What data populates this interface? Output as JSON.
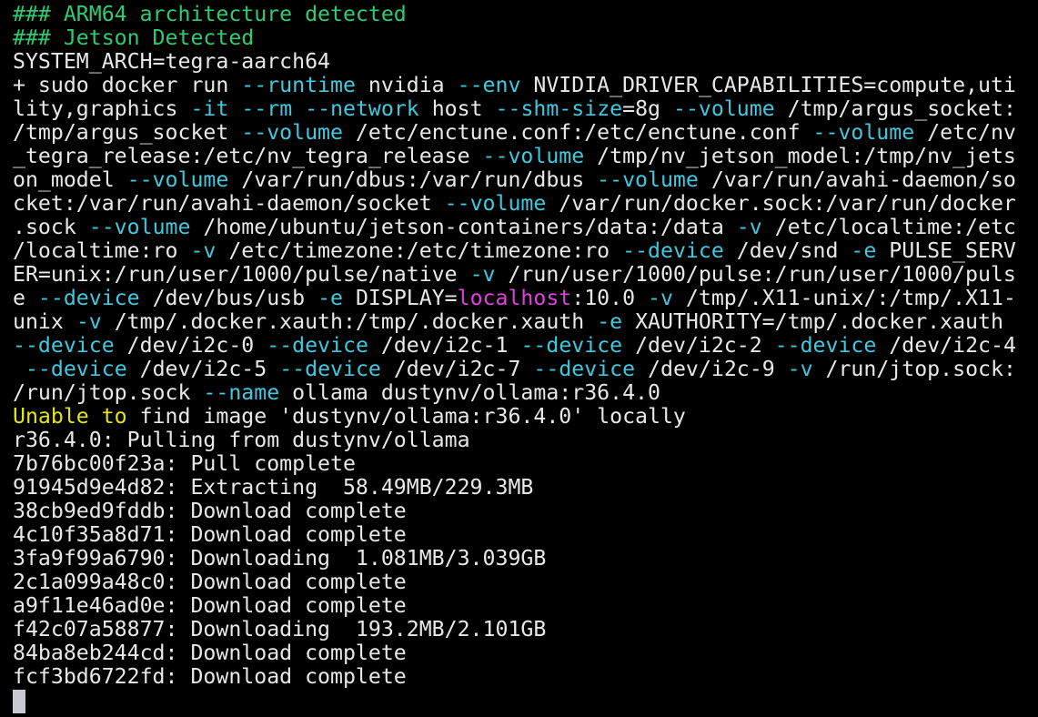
{
  "terminal": {
    "colors": {
      "background": "#000000",
      "default": "#e8e8e8",
      "green": "#2ecc71",
      "cyan": "#3fc9e0",
      "yellow": "#e5e510",
      "magenta": "#e040e0",
      "cursor": "#c9c9d3"
    },
    "lines": [
      [
        {
          "t": "                                 ",
          "c": "default"
        }
      ],
      [
        {
          "t": "### ARM64 architecture detected",
          "c": "green"
        }
      ],
      [
        {
          "t": "### Jetson Detected",
          "c": "green"
        }
      ],
      [
        {
          "t": "SYSTEM_ARCH=tegra-aarch64",
          "c": "default"
        }
      ],
      [
        {
          "t": "+ sudo docker run ",
          "c": "default"
        },
        {
          "t": "--runtime",
          "c": "cyan"
        },
        {
          "t": " nvidia ",
          "c": "default"
        },
        {
          "t": "--env",
          "c": "cyan"
        },
        {
          "t": " NVIDIA_DRIVER_CAPABILITIES=compute,uti",
          "c": "default"
        }
      ],
      [
        {
          "t": "lity,graphics ",
          "c": "default"
        },
        {
          "t": "-it",
          "c": "cyan"
        },
        {
          "t": " ",
          "c": "default"
        },
        {
          "t": "--rm",
          "c": "cyan"
        },
        {
          "t": " ",
          "c": "default"
        },
        {
          "t": "--network",
          "c": "cyan"
        },
        {
          "t": " host ",
          "c": "default"
        },
        {
          "t": "--shm-size",
          "c": "cyan"
        },
        {
          "t": "=8g ",
          "c": "default"
        },
        {
          "t": "--volume",
          "c": "cyan"
        },
        {
          "t": " /tmp/argus_socket:",
          "c": "default"
        }
      ],
      [
        {
          "t": "/tmp/argus_socket ",
          "c": "default"
        },
        {
          "t": "--volume",
          "c": "cyan"
        },
        {
          "t": " /etc/enctune.conf:/etc/enctune.conf ",
          "c": "default"
        },
        {
          "t": "--volume",
          "c": "cyan"
        },
        {
          "t": " /etc/nv",
          "c": "default"
        }
      ],
      [
        {
          "t": "_tegra_release:/etc/nv_tegra_release ",
          "c": "default"
        },
        {
          "t": "--volume",
          "c": "cyan"
        },
        {
          "t": " /tmp/nv_jetson_model:/tmp/nv_jets",
          "c": "default"
        }
      ],
      [
        {
          "t": "on_model ",
          "c": "default"
        },
        {
          "t": "--volume",
          "c": "cyan"
        },
        {
          "t": " /var/run/dbus:/var/run/dbus ",
          "c": "default"
        },
        {
          "t": "--volume",
          "c": "cyan"
        },
        {
          "t": " /var/run/avahi-daemon/so",
          "c": "default"
        }
      ],
      [
        {
          "t": "cket:/var/run/avahi-daemon/socket ",
          "c": "default"
        },
        {
          "t": "--volume",
          "c": "cyan"
        },
        {
          "t": " /var/run/docker.sock:/var/run/docker",
          "c": "default"
        }
      ],
      [
        {
          "t": ".sock ",
          "c": "default"
        },
        {
          "t": "--volume",
          "c": "cyan"
        },
        {
          "t": " /home/ubuntu/jetson-containers/data:/data ",
          "c": "default"
        },
        {
          "t": "-v",
          "c": "cyan"
        },
        {
          "t": " /etc/localtime:/etc",
          "c": "default"
        }
      ],
      [
        {
          "t": "/localtime:ro ",
          "c": "default"
        },
        {
          "t": "-v",
          "c": "cyan"
        },
        {
          "t": " /etc/timezone:/etc/timezone:ro ",
          "c": "default"
        },
        {
          "t": "--device",
          "c": "cyan"
        },
        {
          "t": " /dev/snd ",
          "c": "default"
        },
        {
          "t": "-e",
          "c": "cyan"
        },
        {
          "t": " PULSE_SERV",
          "c": "default"
        }
      ],
      [
        {
          "t": "ER=unix:/run/user/1000/pulse/native ",
          "c": "default"
        },
        {
          "t": "-v",
          "c": "cyan"
        },
        {
          "t": " /run/user/1000/pulse:/run/user/1000/puls",
          "c": "default"
        }
      ],
      [
        {
          "t": "e ",
          "c": "default"
        },
        {
          "t": "--device",
          "c": "cyan"
        },
        {
          "t": " /dev/bus/usb ",
          "c": "default"
        },
        {
          "t": "-e",
          "c": "cyan"
        },
        {
          "t": " DISPLAY=",
          "c": "default"
        },
        {
          "t": "localhost",
          "c": "magenta"
        },
        {
          "t": ":10.0 ",
          "c": "default"
        },
        {
          "t": "-v",
          "c": "cyan"
        },
        {
          "t": " /tmp/.X11-unix/:/tmp/.X11-",
          "c": "default"
        }
      ],
      [
        {
          "t": "unix ",
          "c": "default"
        },
        {
          "t": "-v",
          "c": "cyan"
        },
        {
          "t": " /tmp/.docker.xauth:/tmp/.docker.xauth ",
          "c": "default"
        },
        {
          "t": "-e",
          "c": "cyan"
        },
        {
          "t": " XAUTHORITY=/tmp/.docker.xauth",
          "c": "default"
        }
      ],
      [
        {
          "t": "--device",
          "c": "cyan"
        },
        {
          "t": " /dev/i2c-0 ",
          "c": "default"
        },
        {
          "t": "--device",
          "c": "cyan"
        },
        {
          "t": " /dev/i2c-1 ",
          "c": "default"
        },
        {
          "t": "--device",
          "c": "cyan"
        },
        {
          "t": " /dev/i2c-2 ",
          "c": "default"
        },
        {
          "t": "--device",
          "c": "cyan"
        },
        {
          "t": " /dev/i2c-4",
          "c": "default"
        }
      ],
      [
        {
          "t": " ",
          "c": "default"
        },
        {
          "t": "--device",
          "c": "cyan"
        },
        {
          "t": " /dev/i2c-5 ",
          "c": "default"
        },
        {
          "t": "--device",
          "c": "cyan"
        },
        {
          "t": " /dev/i2c-7 ",
          "c": "default"
        },
        {
          "t": "--device",
          "c": "cyan"
        },
        {
          "t": " /dev/i2c-9 ",
          "c": "default"
        },
        {
          "t": "-v",
          "c": "cyan"
        },
        {
          "t": " /run/jtop.sock:",
          "c": "default"
        }
      ],
      [
        {
          "t": "/run/jtop.sock ",
          "c": "default"
        },
        {
          "t": "--name",
          "c": "cyan"
        },
        {
          "t": " ollama dustynv/ollama:r36.4.0",
          "c": "default"
        }
      ],
      [
        {
          "t": "Unable to",
          "c": "yellow"
        },
        {
          "t": " find image 'dustynv/ollama:r36.4.0' locally",
          "c": "default"
        }
      ],
      [
        {
          "t": "r36.4.0: Pulling from dustynv/ollama",
          "c": "default"
        }
      ],
      [
        {
          "t": "7b76bc00f23a: Pull complete",
          "c": "default"
        }
      ],
      [
        {
          "t": "91945d9e4d82: Extracting  58.49MB/229.3MB",
          "c": "default"
        }
      ],
      [
        {
          "t": "38cb9ed9fddb: Download complete",
          "c": "default"
        }
      ],
      [
        {
          "t": "4c10f35a8d71: Download complete",
          "c": "default"
        }
      ],
      [
        {
          "t": "3fa9f99a6790: Downloading  1.081MB/3.039GB",
          "c": "default"
        }
      ],
      [
        {
          "t": "2c1a099a48c0: Download complete",
          "c": "default"
        }
      ],
      [
        {
          "t": "a9f11e46ad0e: Download complete",
          "c": "default"
        }
      ],
      [
        {
          "t": "f42c07a58877: Downloading  193.2MB/2.101GB",
          "c": "default"
        }
      ],
      [
        {
          "t": "84ba8eb244cd: Download complete",
          "c": "default"
        }
      ],
      [
        {
          "t": "fcf3bd6722fd: Download complete",
          "c": "default"
        }
      ]
    ]
  }
}
